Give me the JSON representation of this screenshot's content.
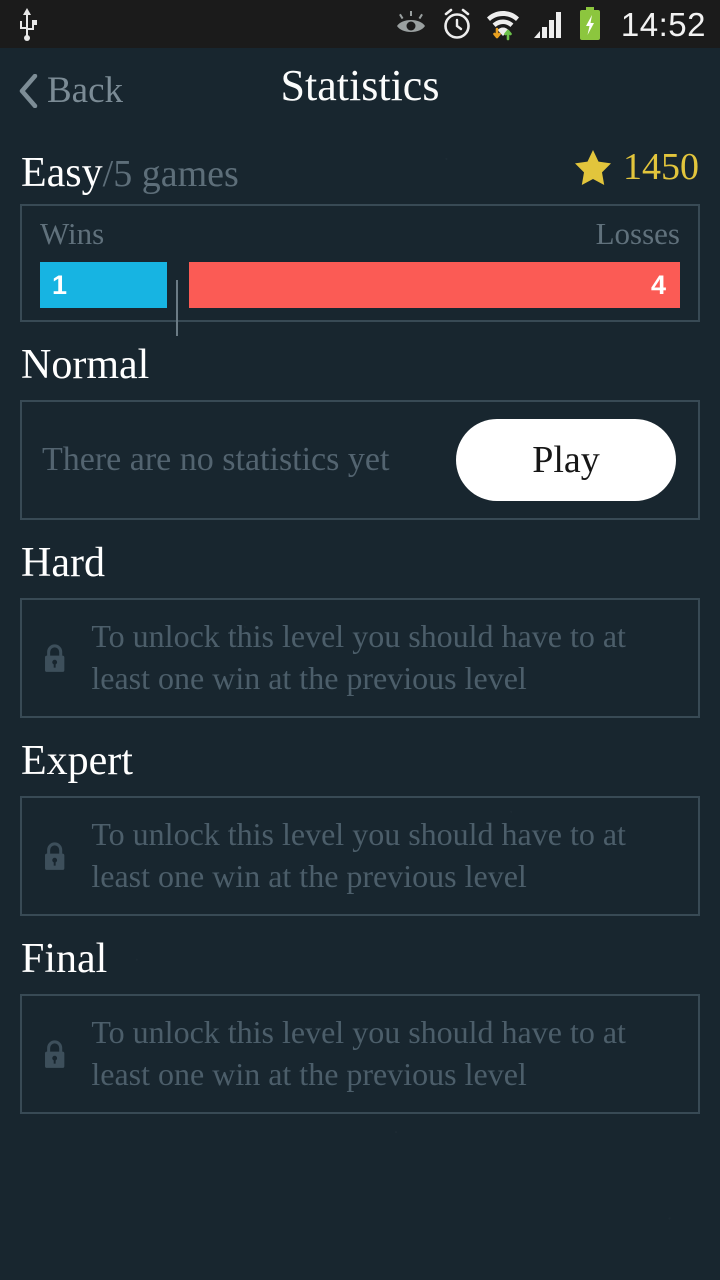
{
  "statusbar": {
    "time": "14:52",
    "icons": [
      "usb-icon",
      "eye-icon",
      "alarm-clock-icon",
      "wifi-icon",
      "signal-icon",
      "battery-charging-icon"
    ]
  },
  "header": {
    "back_label": "Back",
    "back_icon": "chevron-left-icon",
    "title": "Statistics"
  },
  "levels": [
    {
      "name": "Easy",
      "sub": "/5 games",
      "star_icon": "star-icon",
      "score": "1450",
      "state": "stats",
      "wins_label": "Wins",
      "losses_label": "Losses",
      "wins": "1",
      "losses": "4"
    },
    {
      "name": "Normal",
      "sub": "",
      "state": "empty",
      "empty_text": "There are no statistics yet",
      "play_label": "Play"
    },
    {
      "name": "Hard",
      "sub": "",
      "state": "locked",
      "lock_icon": "lock-icon",
      "locked_text": "To unlock this level you should have to at least one win at the previous level"
    },
    {
      "name": "Expert",
      "sub": "",
      "state": "locked",
      "lock_icon": "lock-icon",
      "locked_text": "To unlock this level you should have to at least one win at the previous level"
    },
    {
      "name": "Final",
      "sub": "",
      "state": "locked",
      "lock_icon": "lock-icon",
      "locked_text": "To unlock this level you should have to at least one win at the previous level"
    }
  ],
  "colors": {
    "background": "#18262f",
    "statusbar": "#1b1b1b",
    "wins_bar": "#17b4e2",
    "losses_bar": "#fb5b55",
    "accent_gold": "#e2c53c",
    "card_border": "#384a55",
    "muted_text": "#4c5e6a"
  }
}
